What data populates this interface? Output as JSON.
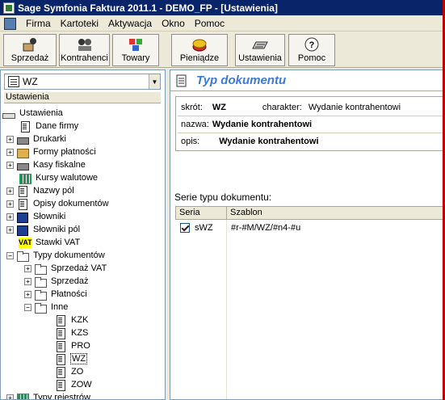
{
  "window": {
    "title": "Sage Symfonia Faktura 2011.1 - DEMO_FP - [Ustawienia]"
  },
  "menu": [
    "Firma",
    "Kartoteki",
    "Aktywacja",
    "Okno",
    "Pomoc"
  ],
  "toolbar": {
    "sprzedaz": "Sprzedaż",
    "kontrahenci": "Kontrahenci",
    "towary": "Towary",
    "pieniadze": "Pieniądze",
    "ustawienia": "Ustawienia",
    "pomoc": "Pomoc"
  },
  "left": {
    "combo_value": "WZ",
    "pane_header": "Ustawienia",
    "tree": {
      "root": "Ustawienia",
      "dane_firmy": "Dane firmy",
      "drukarki": "Drukarki",
      "formy": "Formy płatności",
      "kasy": "Kasy fiskalne",
      "kursy": "Kursy walutowe",
      "nazwy": "Nazwy pól",
      "opisy": "Opisy dokumentów",
      "slowniki": "Słowniki",
      "slowniki_pol": "Słowniki pól",
      "stawki": "Stawki VAT",
      "typy": "Typy dokumentów",
      "sprzedaz_vat": "Sprzedaż VAT",
      "sprzedaz": "Sprzedaż",
      "platnosci": "Płatności",
      "inne": "Inne",
      "kzk": "KZK",
      "kzs": "KZS",
      "pro": "PRO",
      "wz": "WZ",
      "zo": "ZO",
      "zow": "ZOW",
      "rejestrow": "Typy rejestrów"
    },
    "vat_icon_text": "VAT"
  },
  "right": {
    "title": "Typ dokumentu",
    "skrot_label": "skrót:",
    "skrot_value": "WZ",
    "charakter_label": "charakter:",
    "charakter_value": "Wydanie kontrahentowi",
    "nazwa_label": "nazwa:",
    "nazwa_value": "Wydanie kontrahentowi",
    "opis_label": "opis:",
    "opis_value": "Wydanie kontrahentowi",
    "serie_label": "Serie typu dokumentu:",
    "grid": {
      "headers": [
        "Seria",
        "Szablon"
      ],
      "rows": [
        {
          "seria": "sWZ",
          "szablon": "#r-#M/WZ/#n4-#u",
          "checked": true
        }
      ]
    }
  }
}
